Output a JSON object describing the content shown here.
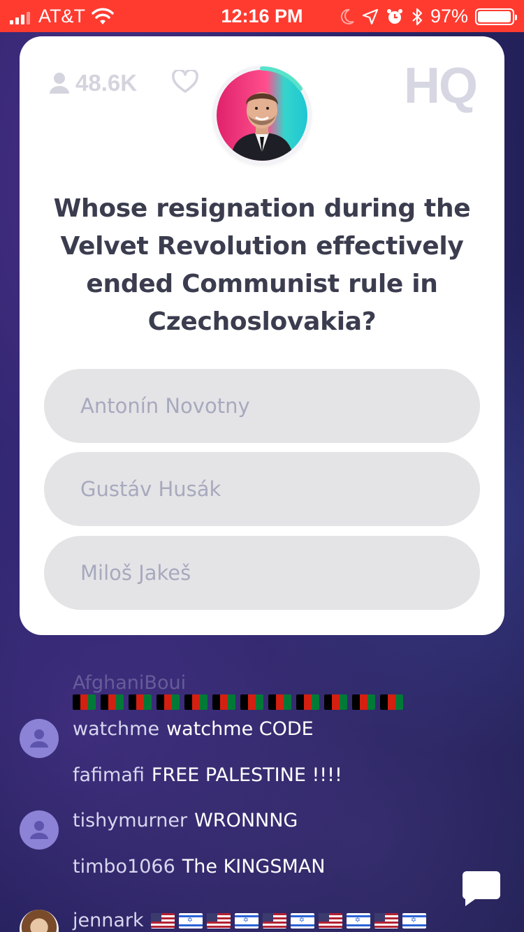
{
  "status_bar": {
    "carrier": "AT&T",
    "time": "12:16 PM",
    "battery": "97%",
    "battery_level": 0.97
  },
  "card": {
    "viewer_count": "48.6K",
    "logo": "HQ",
    "question": "Whose resignation during the Velvet Revolution effectively ended Communist rule in Czechoslovakia?",
    "answers": [
      "Antonín Novotny",
      "Gustáv Husák",
      "Miloš Jakeš"
    ]
  },
  "chat": {
    "faded_user": "AfghaniBoui",
    "messages": [
      {
        "user": "watchme",
        "text": "watchme CODE"
      },
      {
        "user": "fafimafi",
        "text": "FREE PALESTINE !!!!"
      },
      {
        "user": "tishymurner",
        "text": "WRONNNG"
      },
      {
        "user": "timbo1066",
        "text": "The KINGSMAN"
      },
      {
        "user": "jennark",
        "text": ""
      }
    ]
  },
  "icons": {
    "wifi": "wifi-icon",
    "moon": "moon-icon",
    "location": "location-arrow-icon",
    "alarm": "alarm-clock-icon",
    "bluetooth": "bluetooth-icon",
    "battery": "battery-icon",
    "person": "person-icon",
    "heart": "heart-icon",
    "chat": "chat-bubble-icon"
  },
  "colors": {
    "status_bar": "#ff3b30",
    "card": "#ffffff",
    "answer_bg": "#e4e4e7",
    "answer_text": "#a7a9bd",
    "question_text": "#3b3d4f",
    "avatar_bg": "#8c83d6"
  }
}
